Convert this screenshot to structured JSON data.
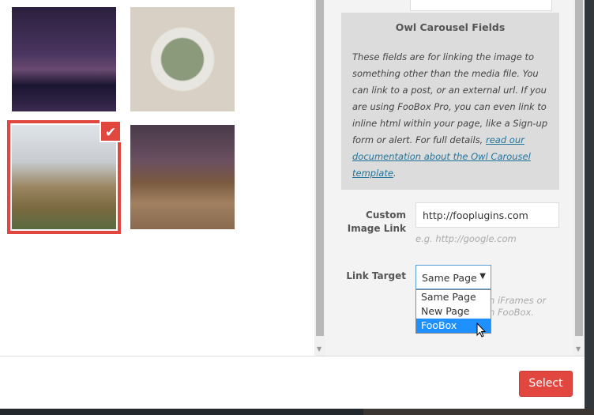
{
  "gallery": {
    "items": [
      {
        "name": "bridge-night-city",
        "selected": false
      },
      {
        "name": "cactus-pot",
        "selected": false
      },
      {
        "name": "misty-forest",
        "selected": true
      },
      {
        "name": "railway-tracks",
        "selected": false
      }
    ],
    "check_icon": "checkmark-icon"
  },
  "owl": {
    "title": "Owl Carousel Fields",
    "description": "These fields are for linking the image to something other than the media file. You can link to a post, or an external url. If you are using FooBox Pro, you can even link to inline html within your page, like a Sign-up form or alert. For full details, ",
    "link_text": "read our documentation about the Owl Carousel template",
    "suffix": "."
  },
  "custom_link": {
    "label": "Custom Image Link",
    "value": "http://fooplugins.com",
    "hint": "e.g. http://google.com"
  },
  "link_target": {
    "label": "Link Target",
    "selected": "Same Page",
    "options": [
      "Same Page",
      "New Page",
      "FooBox"
    ],
    "highlighted": "FooBox",
    "hint_fragment_1": "h iFrames or",
    "hint_fragment_2": "n FooBox."
  },
  "footer": {
    "select_label": "Select"
  },
  "colors": {
    "accent": "#e2473f",
    "highlight": "#1e90ff",
    "link": "#21759b"
  }
}
